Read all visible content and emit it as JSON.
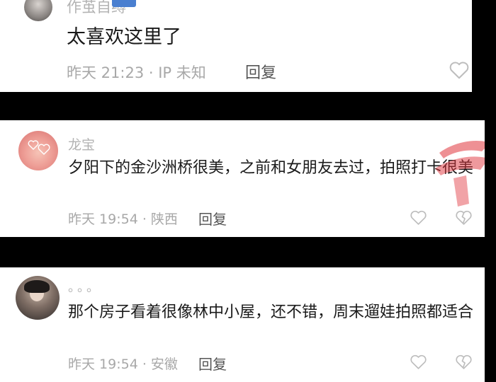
{
  "colors": {
    "background": "#000000",
    "card": "#ffffff",
    "text_primary": "#1a1a1a",
    "text_meta": "#a8a8a8",
    "username": "#b3b3b3",
    "icon_stroke": "#bdbdbd",
    "watermark_red": "#e0343c"
  },
  "comments": [
    {
      "username": "作茧自缚",
      "text": "太喜欢这里了",
      "time": "昨天 21:23",
      "location": "IP 未知",
      "meta": "昨天 21:23 · IP 未知",
      "reply_label": "回复",
      "actions": [
        "heart-icon"
      ]
    },
    {
      "username": "龙宝",
      "text": "夕阳下的金沙洲桥很美，之前和女朋友去过，拍照打卡很美",
      "time": "昨天 19:54",
      "location": "陕西",
      "meta": "昨天 19:54 · 陕西",
      "reply_label": "回复",
      "actions": [
        "heart-icon",
        "broken-heart-icon"
      ]
    },
    {
      "username": "。。。",
      "text": "那个房子看着很像林中小屋，还不错，周末遛娃拍照都适合",
      "time": "昨天 19:54",
      "location": "安徽",
      "meta": "昨天 19:54 · 安徽",
      "reply_label": "回复",
      "actions": [
        "heart-icon",
        "broken-heart-icon"
      ]
    }
  ]
}
